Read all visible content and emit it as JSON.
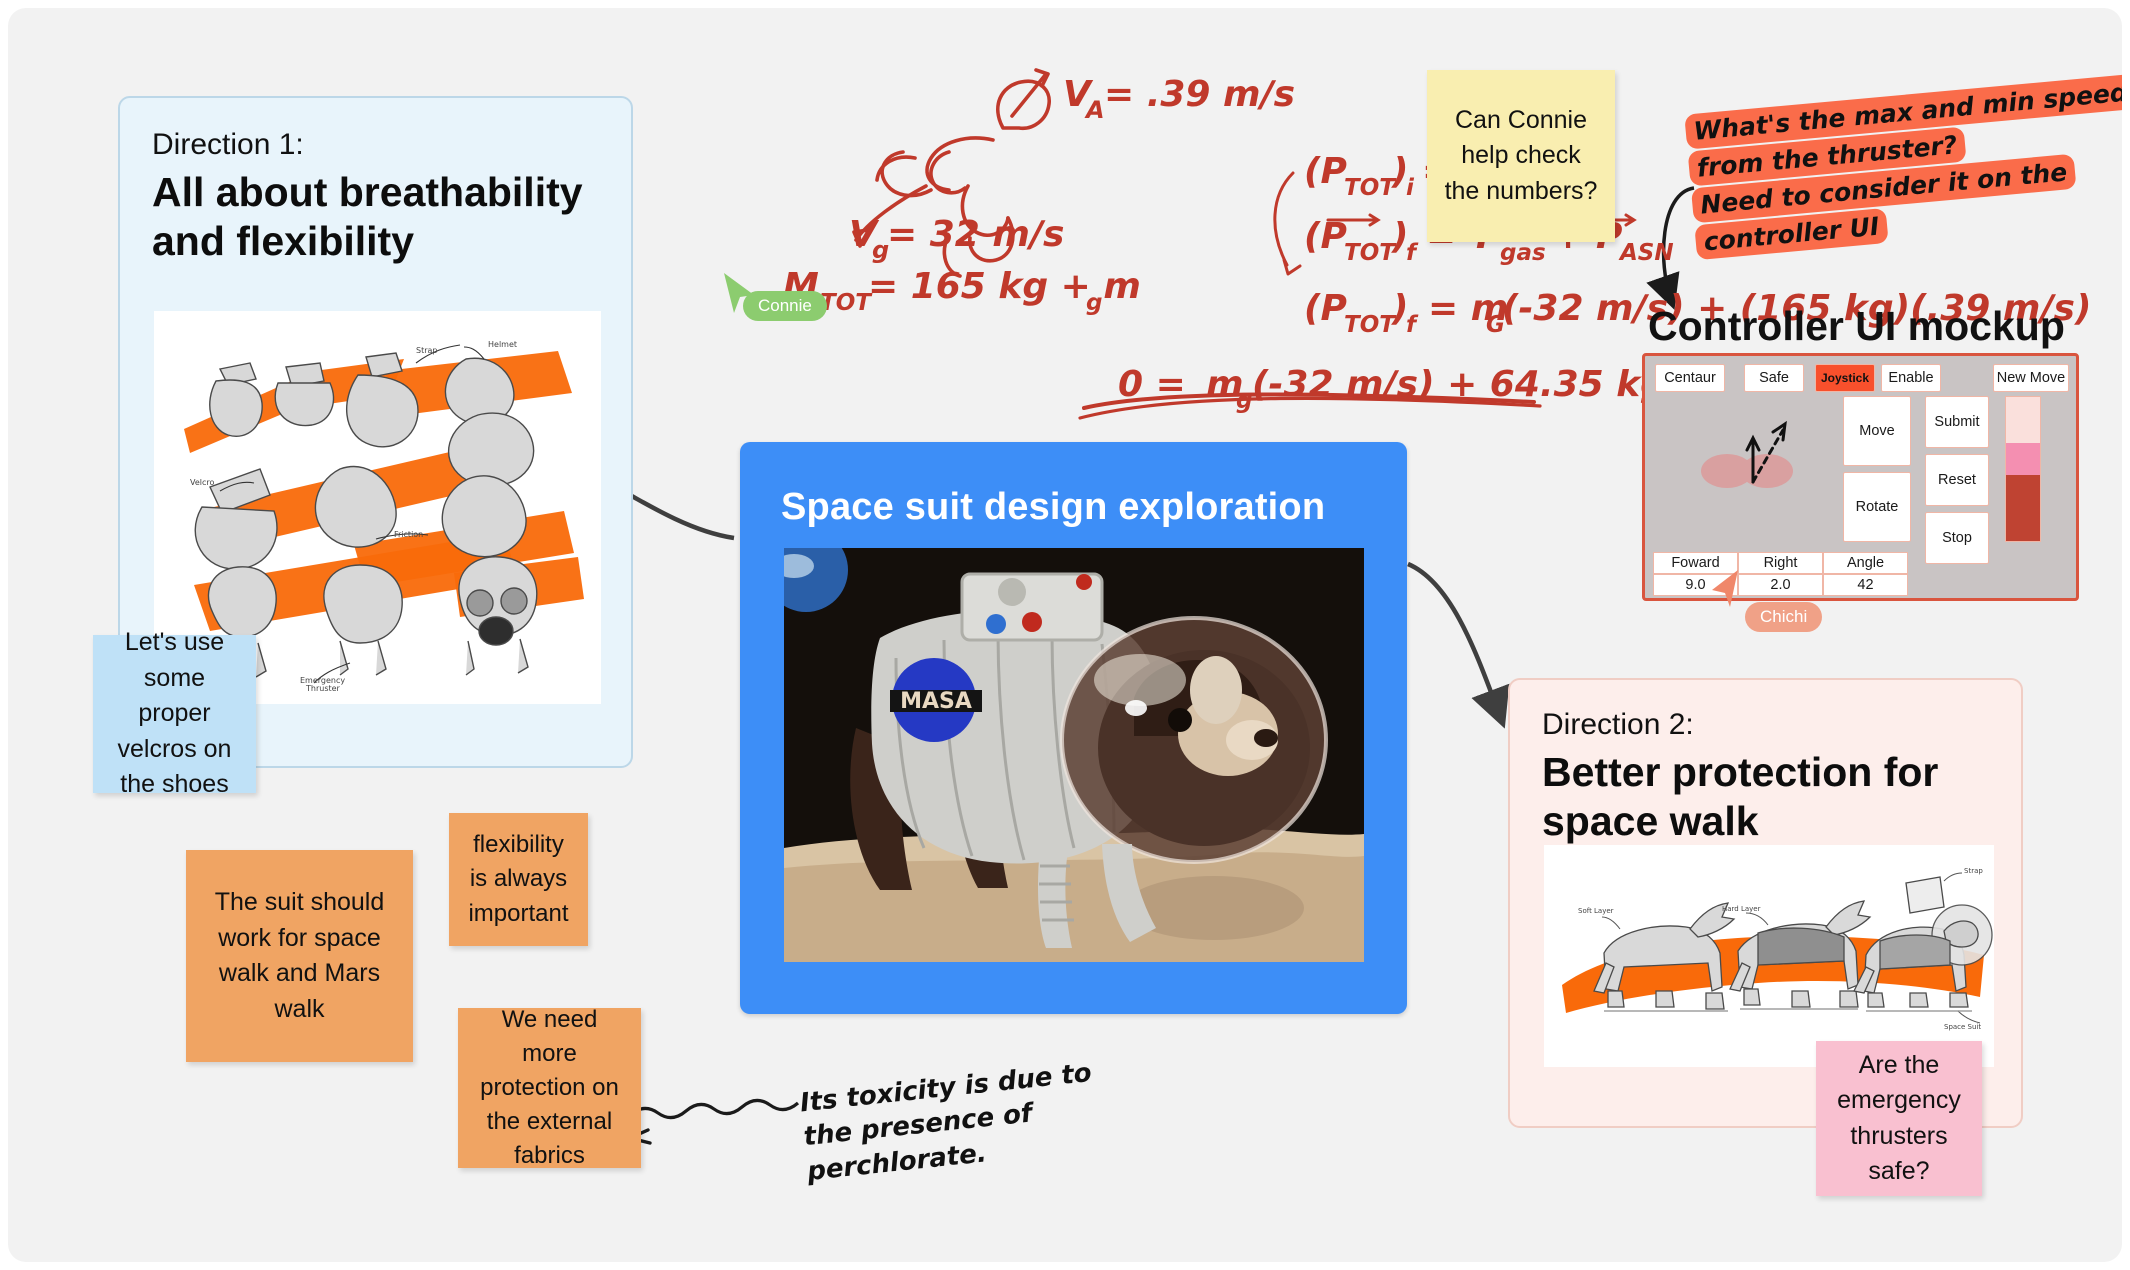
{
  "board": {
    "background_color": "#f2f2f2"
  },
  "direction1": {
    "kicker": "Direction 1:",
    "title": "All about breathability and flexibility",
    "image_alt": "space-suit-component-sketches",
    "background_color": "#e8f4fb"
  },
  "direction2": {
    "kicker": "Direction 2:",
    "title": "Better protection for space walk",
    "image_alt": "space-dog-suit-sketches",
    "background_color": "#fdeeeb"
  },
  "suit_card": {
    "title": "Space suit design exploration",
    "badge_text": "MASA",
    "background_color": "#3d8ef7"
  },
  "notes": {
    "yellow": {
      "text": "Can Connie help check the numbers?",
      "color": "#f9eeb0"
    },
    "blue": {
      "text": "Let's use some proper velcros on the shoes",
      "color": "#bfe1f7"
    },
    "orange1": {
      "text": "The suit should work for space walk and Mars walk",
      "color": "#f0a463"
    },
    "orange2": {
      "text": "flexibility is always important",
      "color": "#f0a463"
    },
    "orange3": {
      "text": "We need more protection on the external fabrics",
      "color": "#f0a463"
    },
    "pink": {
      "text": "Are the emergency thrusters safe?",
      "color": "#f9c0d0"
    }
  },
  "handwriting": {
    "highlight_note": {
      "lines": [
        "What's the max and min speed",
        "from the thruster?",
        "Need to consider it on the",
        "controller UI"
      ],
      "highlight_color": "#fa6c4a"
    },
    "toxicity": {
      "lines": [
        "Its toxicity is due to",
        "the presence of",
        "perchlorate."
      ]
    },
    "equations": {
      "ink_color": "#c0392b",
      "lines": [
        "V_A = .39 m/s",
        "V_g = 32 m/s",
        "M_TOT = 165 kg + m_g",
        "(P_TOT)_i = 0",
        "(P_TOT)_f = P_gas + P_ASN",
        "(P_TOT)_f = m_G(-32 m/s) + (165 kg)(.39 m/s)",
        "0 = m_g(-32 m/s) + 64.35 kg m/s"
      ]
    }
  },
  "controller": {
    "heading": "Controller UI mockup",
    "frame_color": "#d9553e",
    "body_color": "#c9c4c4",
    "top_buttons": [
      "Centaur",
      "Safe",
      "Joystick",
      "Enable"
    ],
    "active_top_button": "Joystick",
    "new_move_button": "New Move",
    "mid_buttons": [
      "Move",
      "Rotate"
    ],
    "action_buttons": [
      "Submit",
      "Reset",
      "Stop"
    ],
    "readout_labels": [
      "Foward",
      "Right",
      "Angle"
    ],
    "readout_values": [
      "9.0",
      "2.0",
      "42"
    ],
    "slider": {
      "segments": [
        {
          "color": "#fae0dc",
          "height_pct": 32
        },
        {
          "color": "#f48fb1",
          "height_pct": 22
        },
        {
          "color": "#bf4332",
          "height_pct": 46
        }
      ]
    }
  },
  "cursors": [
    {
      "name": "Connie",
      "color": "#8ccc6f"
    },
    {
      "name": "Chichi",
      "color": "#f0a187"
    }
  ]
}
